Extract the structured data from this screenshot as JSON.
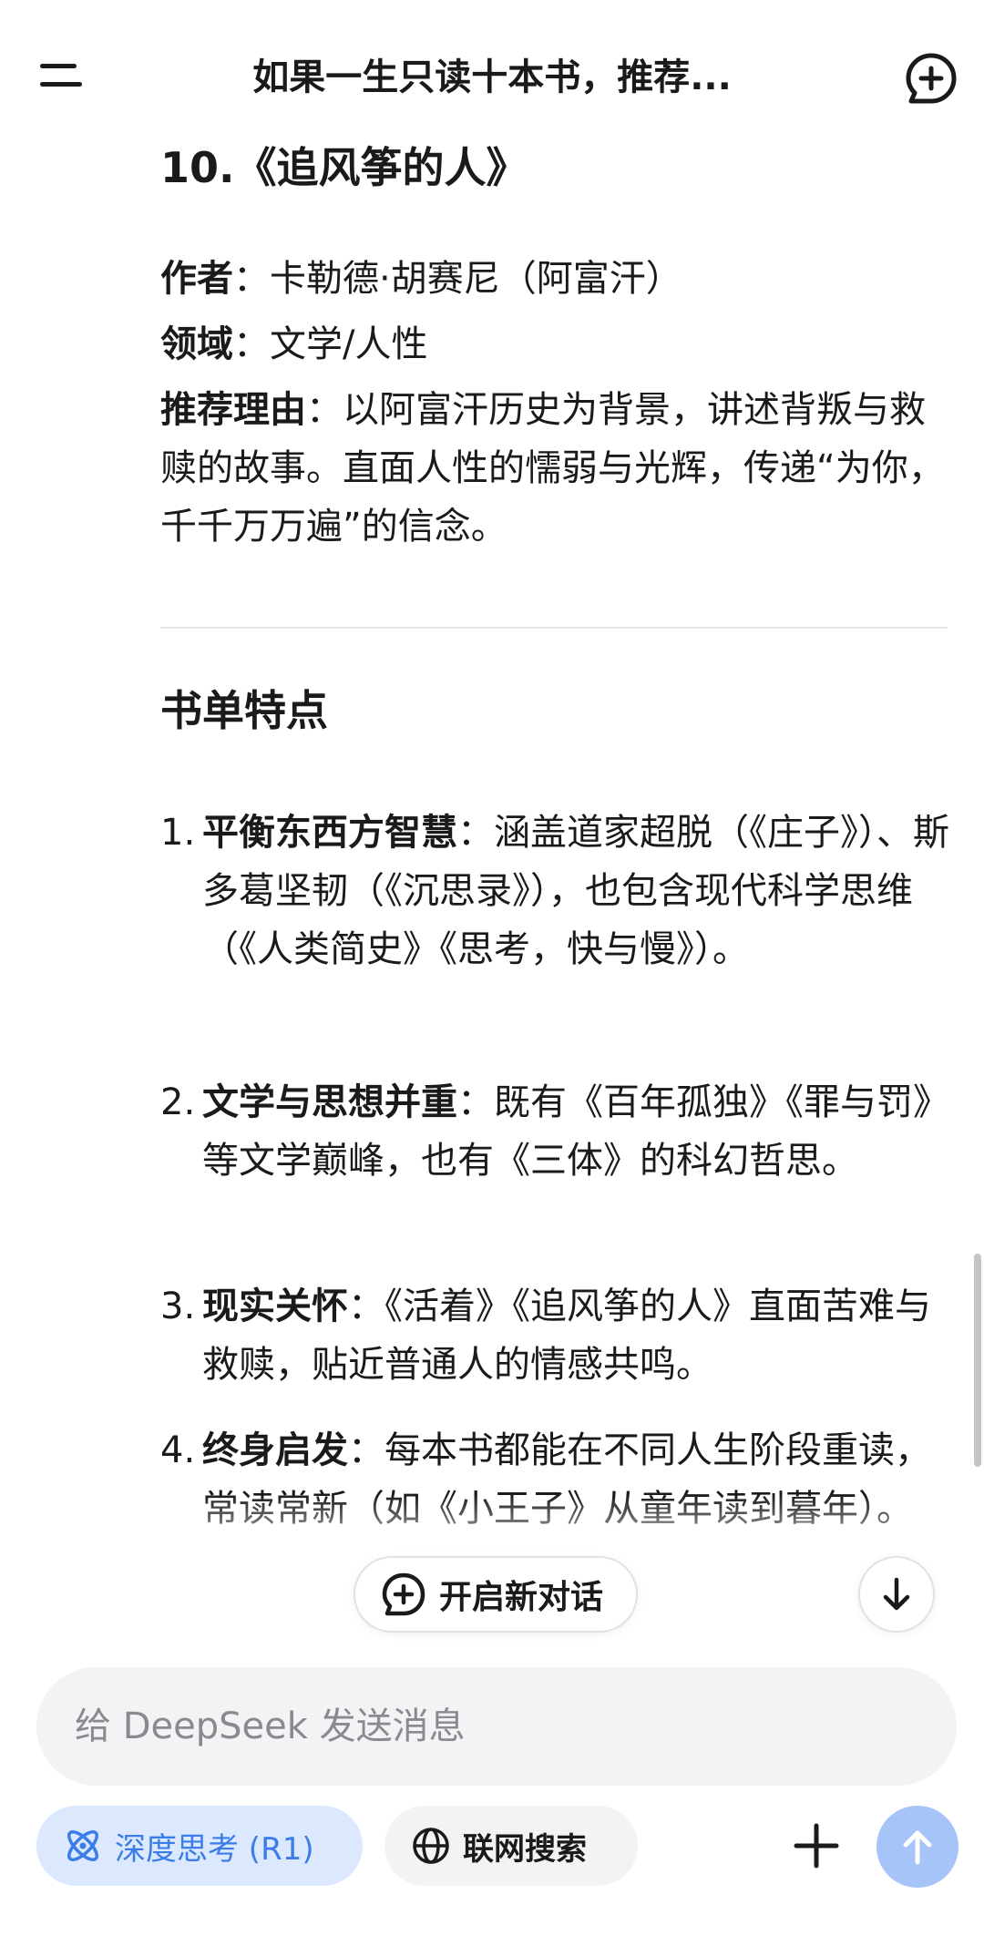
{
  "header": {
    "title": "如果一生只读十本书，推荐..."
  },
  "book": {
    "title": "10.《追风筝的人》",
    "author_label": "作者",
    "author_value": "：卡勒德·胡赛尼（阿富汗）",
    "field_label": "领域",
    "field_value": "：文学/人性",
    "reason_label": "推荐理由",
    "reason_value": "：以阿富汗历史为背景，讲述背叛与救赎的故事。直面人性的懦弱与光辉，传递“为你，千千万万遍”的信念。"
  },
  "section": {
    "title": "书单特点",
    "items": [
      {
        "num": "1.",
        "label": "平衡东西方智慧",
        "text": "：涵盖道家超脱（《庄子》）、斯多葛坚韧（《沉思录》），也包含现代科学思维（《人类简史》《思考，快与慢》）。"
      },
      {
        "num": "2.",
        "label": "文学与思想并重",
        "text": "：既有《百年孤独》《罪与罚》等文学巅峰，也有《三体》的科幻哲思。"
      },
      {
        "num": "3.",
        "label": "现实关怀",
        "text": "：《活着》《追风筝的人》直面苦难与救赎，贴近普通人的情感共鸣。"
      },
      {
        "num": "4.",
        "label": "终身启发",
        "text": "：每本书都能在不同人生阶段重读，常读常新（如《小王子》从童年读到暮年）。"
      }
    ]
  },
  "floating": {
    "new_dialog_label": "开启新对话"
  },
  "input": {
    "placeholder": "给 DeepSeek 发送消息"
  },
  "toolbar": {
    "deep_think_label": "深度思考 (R1)",
    "web_search_label": "联网搜索"
  },
  "colors": {
    "accent": "#3b7de8",
    "chip_active_bg": "#dbe8fd",
    "send_button": "#a6c4f8",
    "input_bg": "#f3f3f5"
  },
  "icons": {
    "menu": "menu-icon",
    "new_chat": "chat-plus-icon",
    "scroll_down": "arrow-down-icon",
    "deep_think": "atom-icon",
    "web_search": "globe-icon",
    "attach": "plus-icon",
    "send": "arrow-up-icon"
  }
}
